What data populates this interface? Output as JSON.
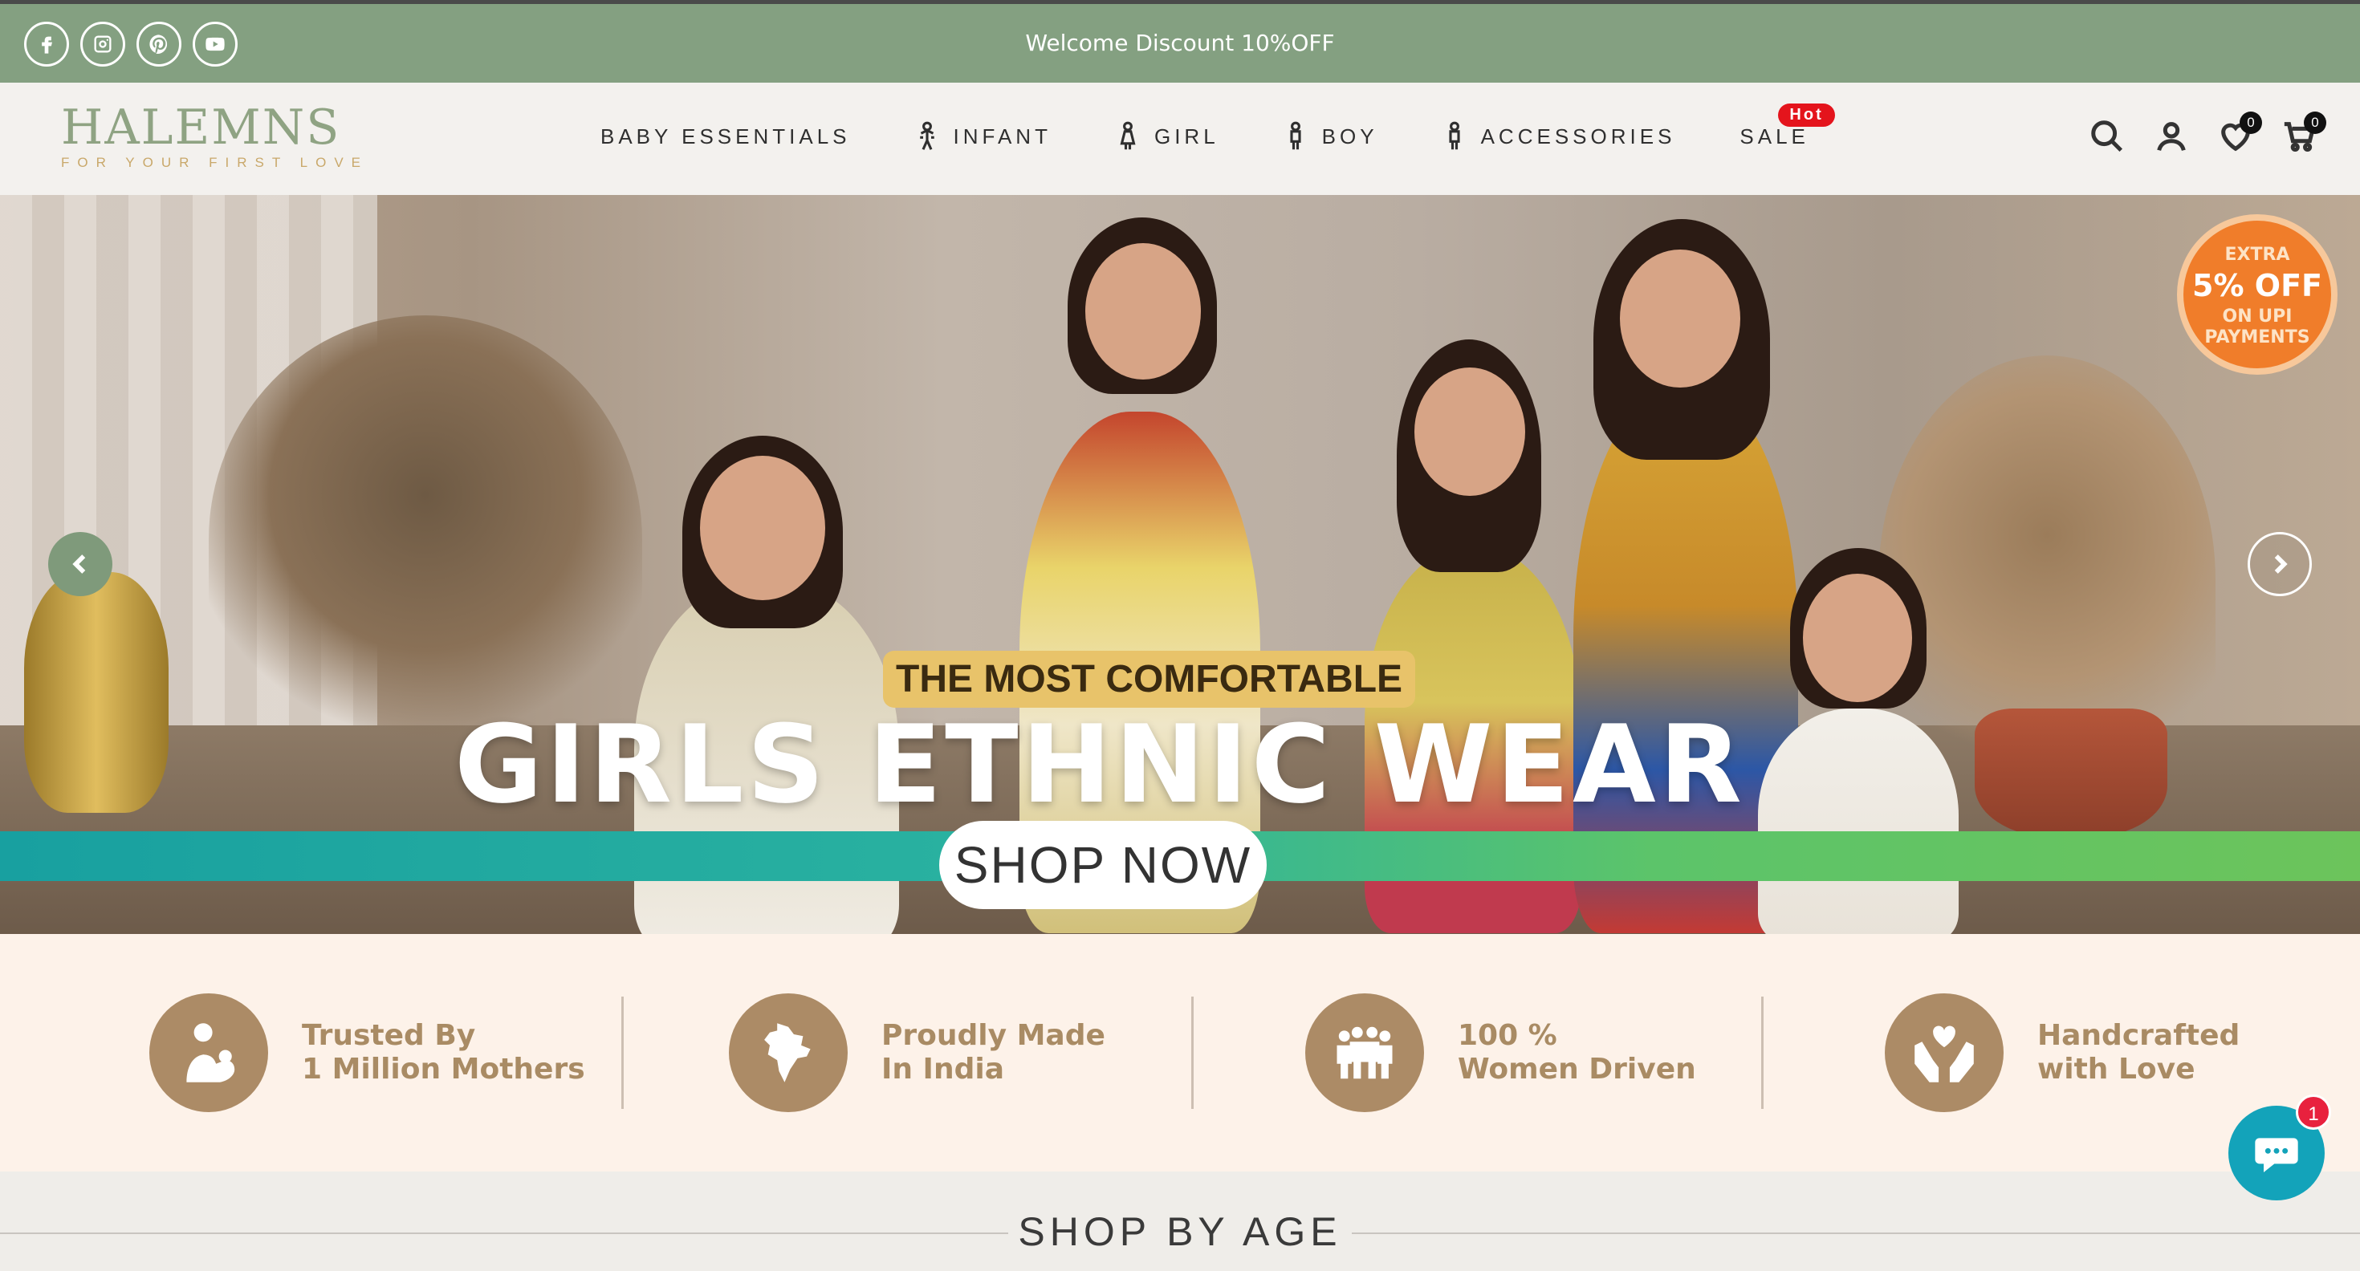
{
  "announcement": {
    "text": "Welcome Discount 10%OFF"
  },
  "social": [
    "facebook-icon",
    "instagram-icon",
    "pinterest-icon",
    "youtube-icon"
  ],
  "logo": {
    "main": "HALEMNS",
    "tagline": "FOR YOUR FIRST LOVE"
  },
  "nav": {
    "items": [
      {
        "label": "BABY ESSENTIALS",
        "icon": ""
      },
      {
        "label": "INFANT",
        "icon": "infant-icon"
      },
      {
        "label": "GIRL",
        "icon": "girl-icon"
      },
      {
        "label": "BOY",
        "icon": "boy-icon"
      },
      {
        "label": "ACCESSORIES",
        "icon": "accessories-icon"
      },
      {
        "label": "SALE",
        "icon": ""
      }
    ],
    "sale_badge": "Hot"
  },
  "header_icons": {
    "wishlist_count": "0",
    "cart_count": "0"
  },
  "hero": {
    "tag": "THE MOST COMFORTABLE",
    "headline": "GIRLS ETHNIC WEAR",
    "cta": "SHOP NOW",
    "offer": {
      "line1": "EXTRA",
      "line2": "5% OFF",
      "line3": "ON UPI",
      "line4": "PAYMENTS"
    }
  },
  "features": [
    {
      "line1": "Trusted By",
      "line2": "1 Million Mothers",
      "icon": "mother-child-icon"
    },
    {
      "line1": "Proudly Made",
      "line2": "In India",
      "icon": "india-map-icon"
    },
    {
      "line1": "100 %",
      "line2": "Women Driven",
      "icon": "women-group-icon"
    },
    {
      "line1": "Handcrafted",
      "line2": "with Love",
      "icon": "hands-heart-icon"
    }
  ],
  "shop_by_age": {
    "title": "SHOP BY AGE"
  },
  "chat": {
    "badge": "1"
  },
  "colors": {
    "accent_green": "#84a081",
    "brown": "#ac8b66",
    "hot_red": "#e4141c",
    "chat_teal": "#13a3ba"
  }
}
